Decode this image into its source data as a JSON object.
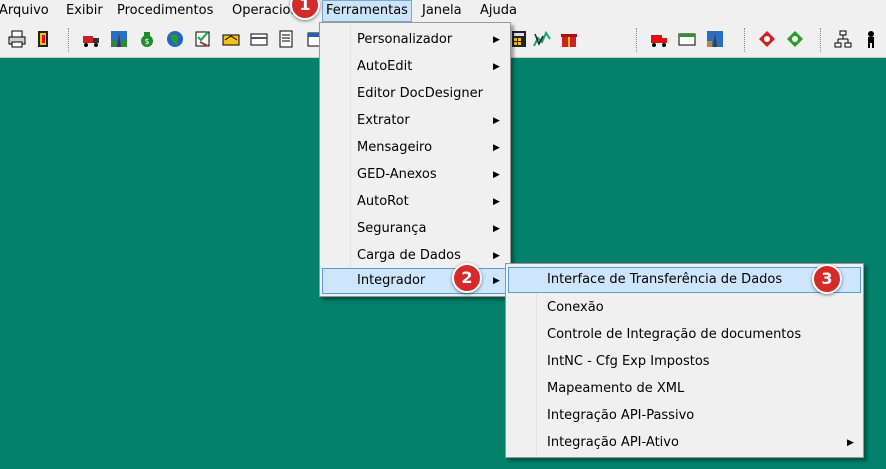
{
  "menubar": {
    "items": [
      "Arquivo",
      "Exibir",
      "Procedimentos",
      "Operacional",
      "Ferramentas",
      "Janela",
      "Ajuda"
    ]
  },
  "toolbar": {
    "icons": [
      "printer-icon",
      "exit-door-icon",
      "truck-icon",
      "road-icon",
      "money-bag-icon",
      "globe-icon",
      "checklist-icon",
      "handshake-icon",
      "card-icon",
      "document-icon",
      "calculator-icon",
      "chart-icon",
      "gift-icon",
      "truck-red-icon",
      "card-green-icon",
      "road-sign-icon",
      "tag-red-icon",
      "tag-green-icon",
      "network-icon",
      "person-icon"
    ]
  },
  "ferramentas_menu": {
    "items": [
      "Personalizador",
      "AutoEdit",
      "Editor DocDesigner",
      "Extrator",
      "Mensageiro",
      "GED-Anexos",
      "AutoRot",
      "Segurança",
      "Carga de Dados",
      "Integrador"
    ],
    "has_submenu": [
      true,
      true,
      false,
      true,
      true,
      true,
      true,
      true,
      true,
      true
    ]
  },
  "integrador_submenu": {
    "items": [
      "Interface de Transferência de Dados",
      "Conexão",
      "Controle de Integração de documentos",
      "IntNC - Cfg Exp Impostos",
      "Mapeamento de XML",
      "Integração API-Passivo",
      "Integração API-Ativo"
    ],
    "has_submenu": [
      false,
      false,
      false,
      false,
      false,
      false,
      true
    ]
  },
  "callouts": [
    "1",
    "2",
    "3"
  ],
  "colors": {
    "desktop": "#03816a",
    "highlight": "#cde6fb",
    "callout": "#d42a2a"
  }
}
